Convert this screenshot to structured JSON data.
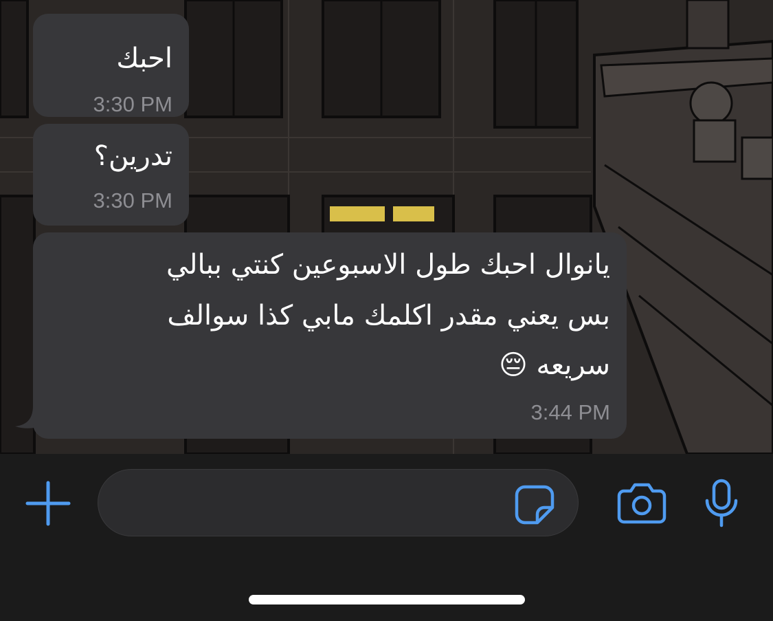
{
  "theme": {
    "bubble_color": "#37373a",
    "timestamp_color": "#8e8e93",
    "accent_color": "#4f9bf0",
    "input_bar_color": "#1b1b1b"
  },
  "messages": [
    {
      "text": "احبك",
      "time": "3:30 PM",
      "direction": "incoming"
    },
    {
      "text": "تدرين؟",
      "time": "3:30 PM",
      "direction": "incoming"
    },
    {
      "lines": [
        "يانوال احبك طول الاسبوعين كنتي ببالي",
        "بس يعني مقدر اكلمك مابي كذا سوالف",
        "سريعه 😔"
      ],
      "time": "3:44 PM",
      "direction": "incoming"
    }
  ],
  "composer": {
    "value": "",
    "placeholder": "",
    "icons": [
      "plus-icon",
      "sticker-icon",
      "camera-icon",
      "microphone-icon"
    ]
  }
}
